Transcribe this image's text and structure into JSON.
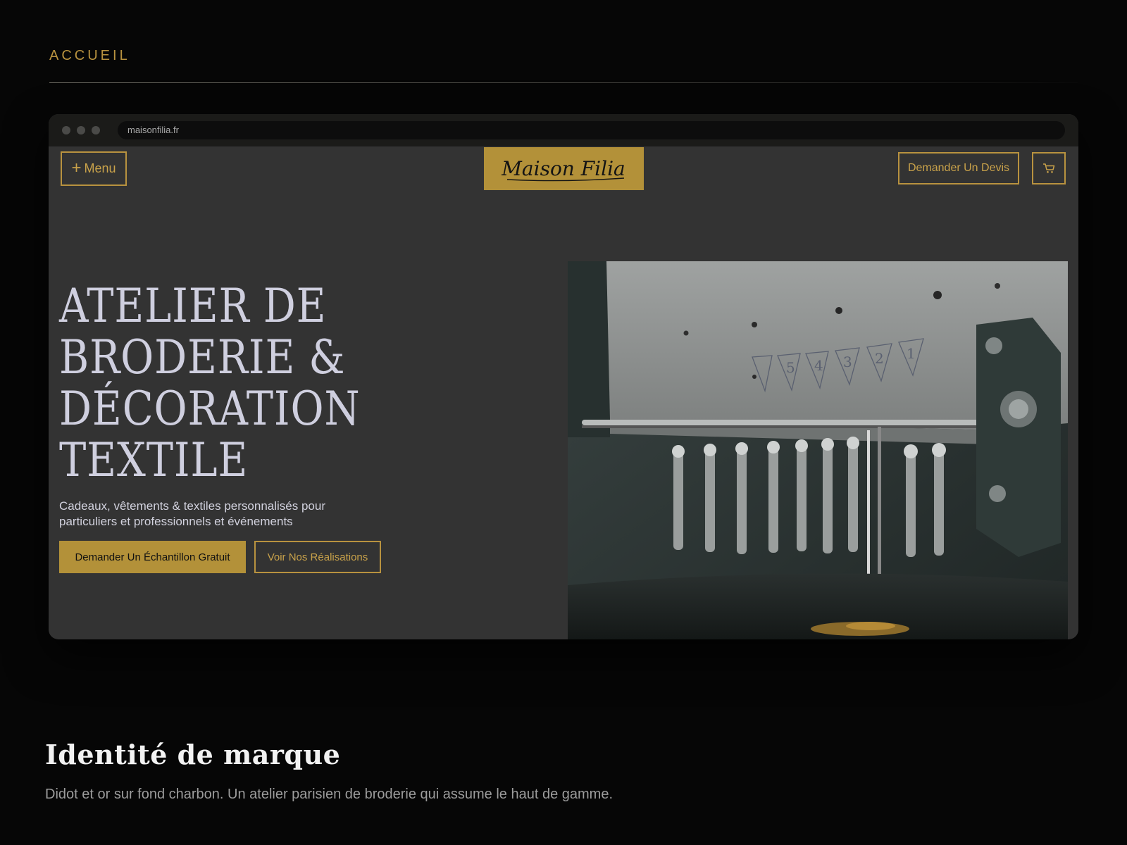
{
  "section": {
    "label": "ACCUEIL"
  },
  "browser": {
    "url": "maisonfilia.fr"
  },
  "site": {
    "menu_label": "Menu",
    "logo_text": "Maison Filia",
    "quote_label": "Demander Un Devis",
    "cart_icon": "cart-icon",
    "hero": {
      "title_lines": [
        "ATELIER DE",
        "BRODERIE &",
        "DÉCORATION",
        "TEXTILE"
      ],
      "subtitle_line1": "Cadeaux, vêtements & textiles personnalisés pour",
      "subtitle_line2": "particuliers et professionnels et événements",
      "cta_primary": "Demander Un Échantillon Gratuit",
      "cta_secondary": "Voir Nos Réalisations"
    }
  },
  "brand": {
    "title": "Identité de marque",
    "description": "Didot et or sur fond charbon. Un atelier parisien de broderie qui assume le haut de gamme."
  },
  "colors": {
    "gold": "#b39139",
    "charcoal": "#333333",
    "background": "#060606"
  }
}
